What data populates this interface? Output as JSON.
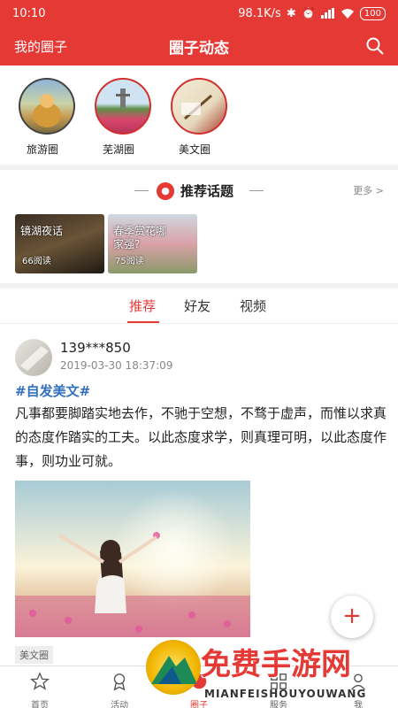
{
  "status_bar": {
    "time": "10:10",
    "speed": "98.1K/s",
    "battery": "100"
  },
  "header": {
    "left_label": "我的圈子",
    "title": "圈子动态"
  },
  "circles": [
    {
      "label": "旅游圈"
    },
    {
      "label": "芜湖圈"
    },
    {
      "label": "美文圈"
    }
  ],
  "topics": {
    "title": "推荐话题",
    "more": "更多 >",
    "items": [
      {
        "title": "镜湖夜话",
        "reads": "66阅读"
      },
      {
        "title": "春季赏花哪\n家强?",
        "reads": "75阅读"
      }
    ]
  },
  "tabs": [
    {
      "label": "推荐",
      "active": true
    },
    {
      "label": "好友",
      "active": false
    },
    {
      "label": "视频",
      "active": false
    }
  ],
  "post": {
    "username": "139***850",
    "time": "2019-03-30 18:37:09",
    "tag": "#自发美文#",
    "content": "凡事都要脚踏实地去作，不驰于空想，不骛于虚声，而惟以求真的态度作踏实的工夫。以此态度求学，则真理可明，以此态度作事，则功业可就。",
    "circle_tag": "美文圈"
  },
  "fab": {
    "label": "+"
  },
  "bottom_nav": [
    {
      "label": "首页",
      "icon": "star-icon"
    },
    {
      "label": "活动",
      "icon": "medal-icon"
    },
    {
      "label": "圈子",
      "icon": "circle-icon",
      "active": true
    },
    {
      "label": "服务",
      "icon": "grid-icon"
    },
    {
      "label": "我",
      "icon": "user-icon"
    }
  ],
  "watermark": {
    "text": "免费手游网",
    "sub": "MIANFEISHOUYOUWANG"
  },
  "colors": {
    "accent": "#e53935",
    "tag_blue": "#2f6fbf"
  }
}
